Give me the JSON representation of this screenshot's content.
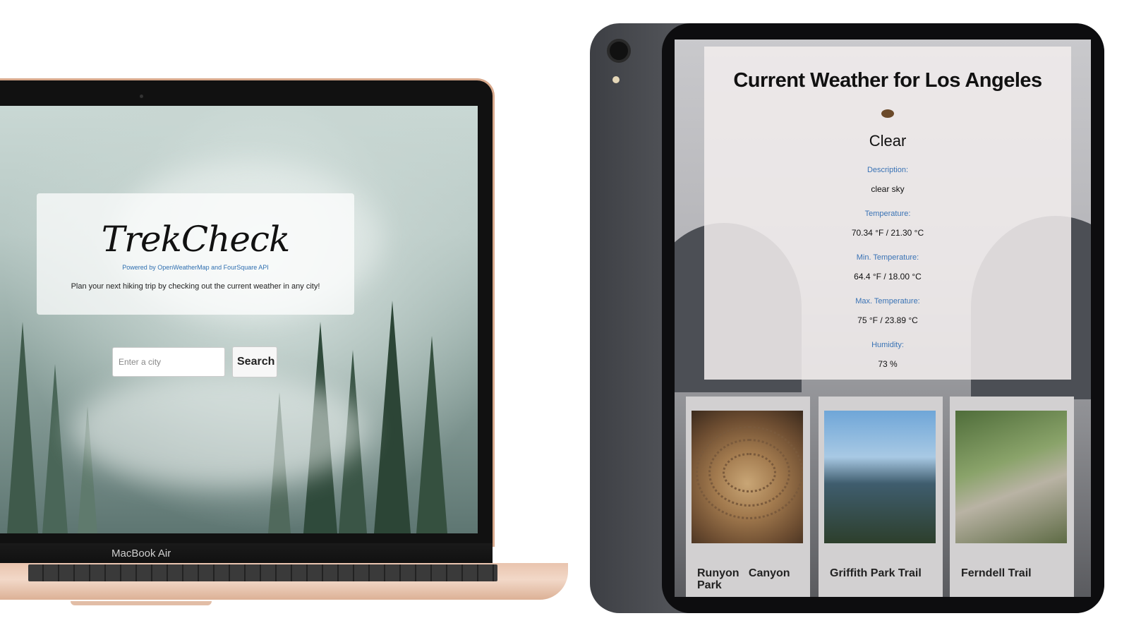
{
  "laptop": {
    "device_label": "MacBook Air",
    "app": {
      "title": "TrekCheck",
      "powered_by": "Powered by OpenWeatherMap and FourSquare API",
      "tagline": "Plan your next hiking trip by checking out the current weather in any city!",
      "search": {
        "placeholder": "Enter a city",
        "button_label": "Search"
      }
    }
  },
  "tablet": {
    "weather": {
      "title": "Current Weather for Los Angeles",
      "main": "Clear",
      "fields": [
        {
          "label": "Description:",
          "value": "clear sky"
        },
        {
          "label": "Temperature:",
          "value": "70.34 °F / 21.30 °C"
        },
        {
          "label": "Min. Temperature:",
          "value": "64.4 °F / 18.00 °C"
        },
        {
          "label": "Max. Temperature:",
          "value": "75 °F / 23.89 °C"
        },
        {
          "label": "Humidity:",
          "value": "73 %"
        }
      ]
    },
    "trails": [
      {
        "name": "Runyon   Canyon Park"
      },
      {
        "name": "Griffith Park Trail"
      },
      {
        "name": "Ferndell Trail"
      }
    ]
  },
  "colors": {
    "accent_link": "#3a73b5",
    "laptop_body": "#e9c4ae",
    "tablet_body": "#3d3f44"
  }
}
